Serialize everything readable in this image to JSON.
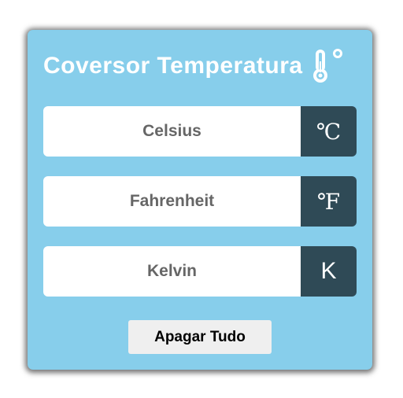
{
  "header": {
    "title": "Coversor Temperatura",
    "icon": "thermometer-icon"
  },
  "fields": [
    {
      "placeholder": "Celsius",
      "value": "",
      "unit": "℃"
    },
    {
      "placeholder": "Fahrenheit",
      "value": "",
      "unit": "℉"
    },
    {
      "placeholder": "Kelvin",
      "value": "",
      "unit": "K"
    }
  ],
  "actions": {
    "clear_label": "Apagar Tudo"
  },
  "colors": {
    "card_background": "#87ceeb",
    "unit_background": "#2f4a56",
    "text_on_card": "#ffffff",
    "button_background": "#efefef"
  }
}
